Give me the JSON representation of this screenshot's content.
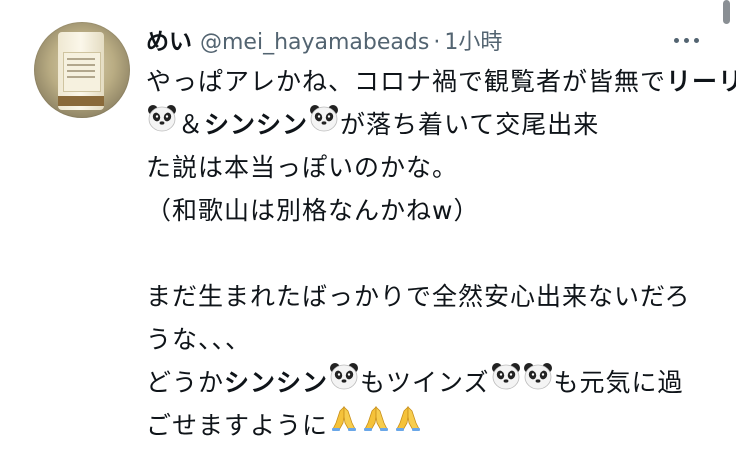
{
  "user": {
    "name": "めい",
    "handle": "@mei_hayamabeads",
    "separator": "·",
    "time": "1小時"
  },
  "tweet": {
    "l1": "やっぱアレかね、コロナ禍で観覧者が皆無で",
    "name_riri": "リーリー",
    "amp": "＆",
    "name_shinshin": "シンシン",
    "l2_tail": "が落ち着いて交尾出来",
    "l3": "た説は本当っぽいのかな。",
    "l4": "（和歌山は別格なんかねw）",
    "l5": "まだ生まれたばっかりで全然安心出来ないだろ",
    "l6": "うな、、、",
    "l7_head": "どうか",
    "l7_mo": "もツインズ",
    "l7_tail": "も元気に過",
    "l8": "ごせますように",
    "emoji": {
      "panda": "panda-face-icon",
      "pray": "folded-hands-icon"
    }
  },
  "colors": {
    "text": "#0f1419",
    "secondary": "#536471",
    "background": "#ffffff"
  }
}
